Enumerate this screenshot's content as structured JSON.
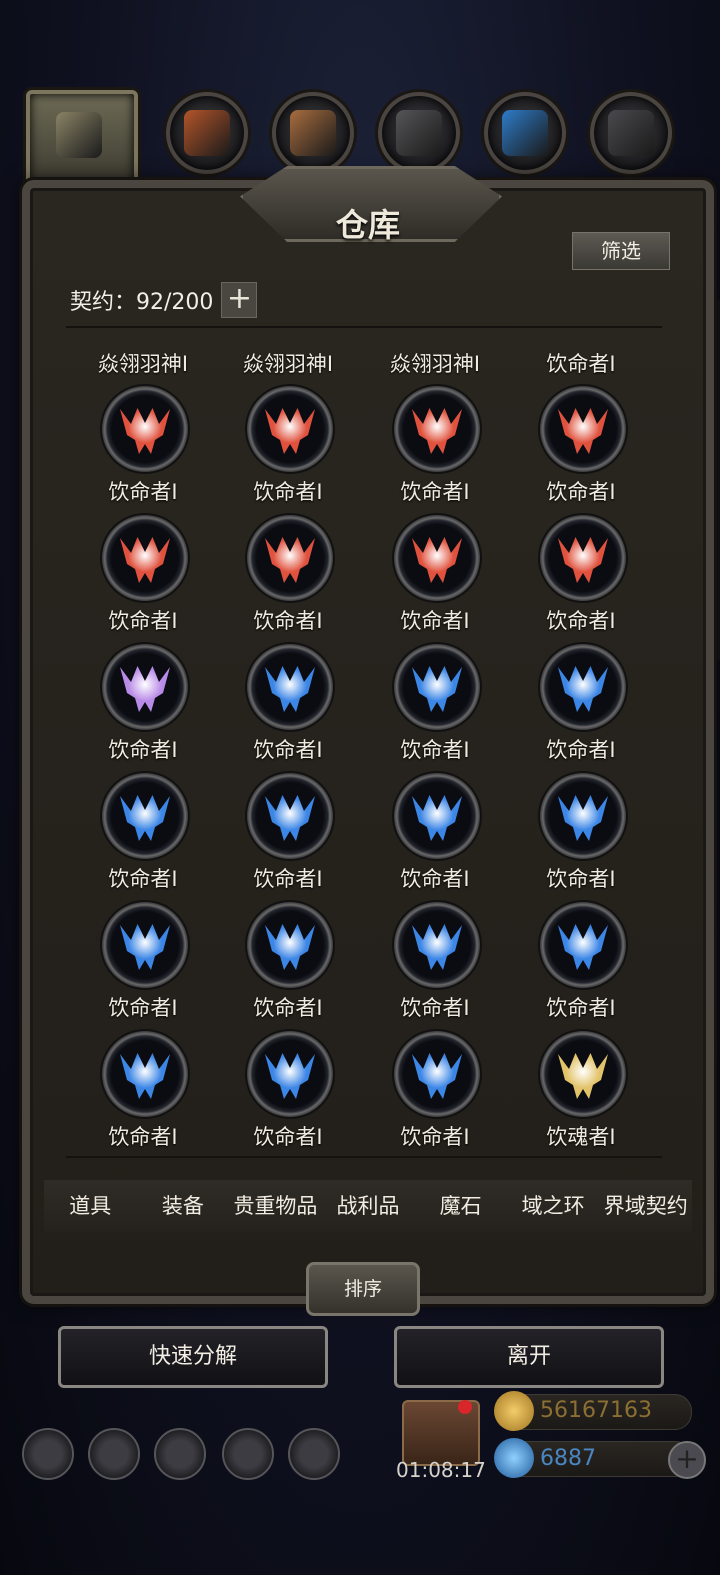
{
  "header": {
    "tabs": [
      {
        "icon": "emblem-tab-icon",
        "active": true,
        "color": "#8a8466"
      },
      {
        "icon": "material-tab-icon",
        "color": "#b4552a"
      },
      {
        "icon": "wood-tab-icon",
        "color": "#a86d3f"
      },
      {
        "icon": "metal-tab-icon",
        "color": "#555558"
      },
      {
        "icon": "crystal-tab-icon",
        "color": "#2e7cc9"
      },
      {
        "icon": "stone-tab-icon",
        "color": "#4a4a4e"
      }
    ]
  },
  "panel": {
    "title": "仓库",
    "filter_label": "筛选",
    "contract_label": "契约：92/200",
    "plus_label": "+"
  },
  "items": {
    "partial_row": [
      "焱翎羽神Ⅰ",
      "焱翎羽神Ⅰ",
      "焱翎羽神Ⅰ",
      "饮命者Ⅰ"
    ],
    "rows": [
      [
        {
          "label": "饮命者Ⅰ",
          "color": "#e0523e"
        },
        {
          "label": "饮命者Ⅰ",
          "color": "#e0523e"
        },
        {
          "label": "饮命者Ⅰ",
          "color": "#e0523e"
        },
        {
          "label": "饮命者Ⅰ",
          "color": "#e0523e"
        }
      ],
      [
        {
          "label": "饮命者Ⅰ",
          "color": "#e0523e"
        },
        {
          "label": "饮命者Ⅰ",
          "color": "#e0523e"
        },
        {
          "label": "饮命者Ⅰ",
          "color": "#e0523e"
        },
        {
          "label": "饮命者Ⅰ",
          "color": "#e0523e"
        }
      ],
      [
        {
          "label": "饮命者Ⅰ",
          "color": "#b98be8"
        },
        {
          "label": "饮命者Ⅰ",
          "color": "#3c86e6"
        },
        {
          "label": "饮命者Ⅰ",
          "color": "#3c86e6"
        },
        {
          "label": "饮命者Ⅰ",
          "color": "#3c86e6"
        }
      ],
      [
        {
          "label": "饮命者Ⅰ",
          "color": "#3c86e6"
        },
        {
          "label": "饮命者Ⅰ",
          "color": "#3c86e6"
        },
        {
          "label": "饮命者Ⅰ",
          "color": "#3c86e6"
        },
        {
          "label": "饮命者Ⅰ",
          "color": "#3c86e6"
        }
      ],
      [
        {
          "label": "饮命者Ⅰ",
          "color": "#3c86e6"
        },
        {
          "label": "饮命者Ⅰ",
          "color": "#3c86e6"
        },
        {
          "label": "饮命者Ⅰ",
          "color": "#3c86e6"
        },
        {
          "label": "饮命者Ⅰ",
          "color": "#3c86e6"
        }
      ],
      [
        {
          "label": "饮命者Ⅰ",
          "color": "#3c86e6"
        },
        {
          "label": "饮命者Ⅰ",
          "color": "#3c86e6"
        },
        {
          "label": "饮命者Ⅰ",
          "color": "#3c86e6"
        },
        {
          "label": "饮魂者Ⅰ",
          "color": "#e2c36a"
        }
      ]
    ]
  },
  "categories": [
    "道具",
    "装备",
    "贵重物品",
    "战利品",
    "魔石",
    "域之环",
    "界域契约"
  ],
  "actions": {
    "sort_label": "排序",
    "quick_decompose_label": "快速分解",
    "leave_label": "离开"
  },
  "footer": {
    "timer": "01:08:17",
    "gold": "56167163",
    "gems": "6887",
    "gold_color": "#e0b24a",
    "gem_color": "#5aa6e8",
    "add_label": "+",
    "bottom_icons": [
      "settings-icon",
      "badge-icon",
      "guild-icon",
      "mail-icon",
      "shop-icon"
    ]
  }
}
